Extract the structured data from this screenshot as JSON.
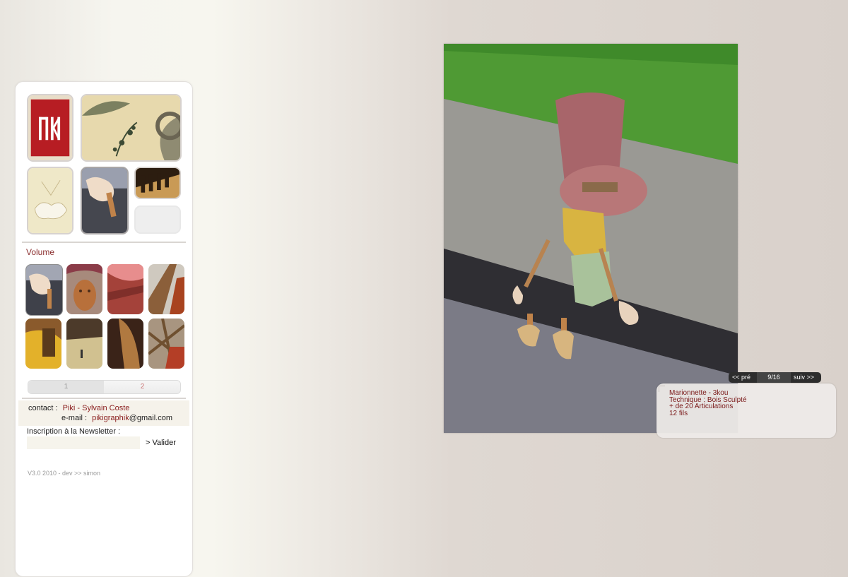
{
  "sidebar": {
    "section_title": "Volume",
    "pages": [
      "1",
      "2"
    ],
    "contact": {
      "label": "contact :",
      "name": "Piki - Sylvain Coste",
      "email_label": "e-mail :",
      "email_user": "pikigraphik",
      "email_domain": "@gmail.com"
    },
    "newsletter": {
      "label": "Inscription à la Newsletter :",
      "placeholder": "",
      "submit": "> Valider"
    },
    "footer": "V3.0 2010 - dev >> simon"
  },
  "viewer": {
    "prev": "<< pré",
    "counter": "9/16",
    "next": "suiv >>",
    "caption": [
      "Marionnette - 3kou",
      "Technique : Bois Sculpté",
      "+ de 20 Articulations",
      "12 fils"
    ]
  },
  "colors": {
    "accent": "#8b2f2f",
    "caption_text": "#7a1818",
    "nav_bg": "#2d2d2d"
  }
}
